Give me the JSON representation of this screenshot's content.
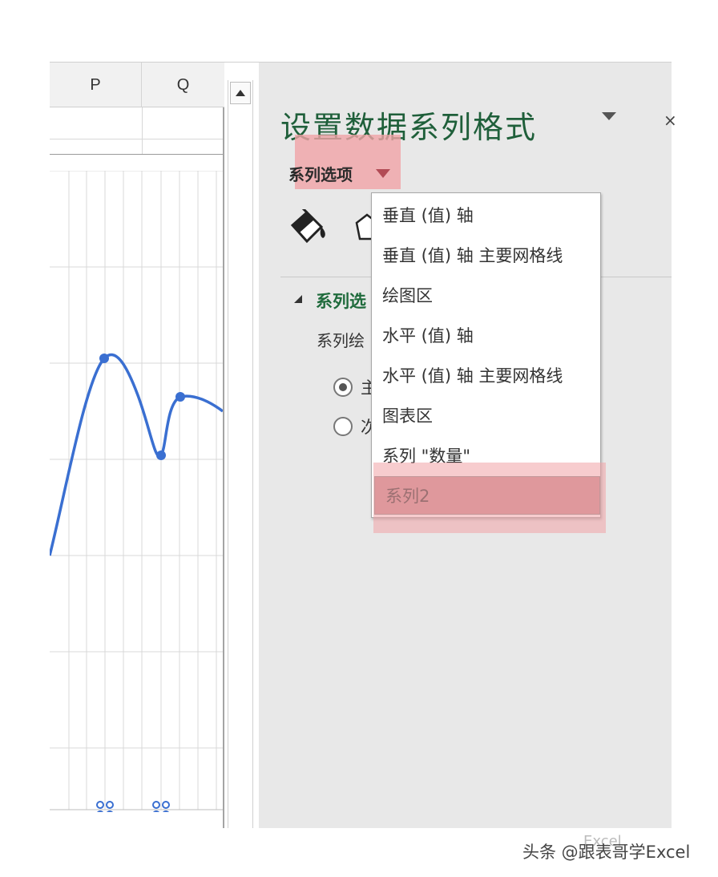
{
  "spreadsheet": {
    "columns": [
      "P",
      "Q"
    ]
  },
  "chart": {
    "line_color": "#3a6fd1",
    "grid_color": "#d9d9d9",
    "handle_icon": "resize-handle-icon"
  },
  "pane": {
    "title": "设置数据系列格式",
    "options_dropdown_label": "系列选项",
    "fill_icon": "paint-bucket-icon",
    "effects_icon": "pentagon-icon",
    "section_label": "系列选",
    "plot_on_label": "系列绘",
    "radio_primary_label": "主",
    "radio_secondary_label": "次",
    "highlight_color": "#f0a3a6"
  },
  "dropdown": {
    "items": [
      {
        "label": "垂直 (值) 轴"
      },
      {
        "label": "垂直 (值) 轴 主要网格线"
      },
      {
        "label": "绘图区"
      },
      {
        "label": "水平 (值) 轴"
      },
      {
        "label": "水平 (值) 轴 主要网格线"
      },
      {
        "label": "图表区"
      },
      {
        "label": "系列 \"数量\""
      },
      {
        "label": "系列2"
      }
    ],
    "selected_index": 7
  },
  "watermark": {
    "text": "头条 @跟表哥学Excel"
  }
}
